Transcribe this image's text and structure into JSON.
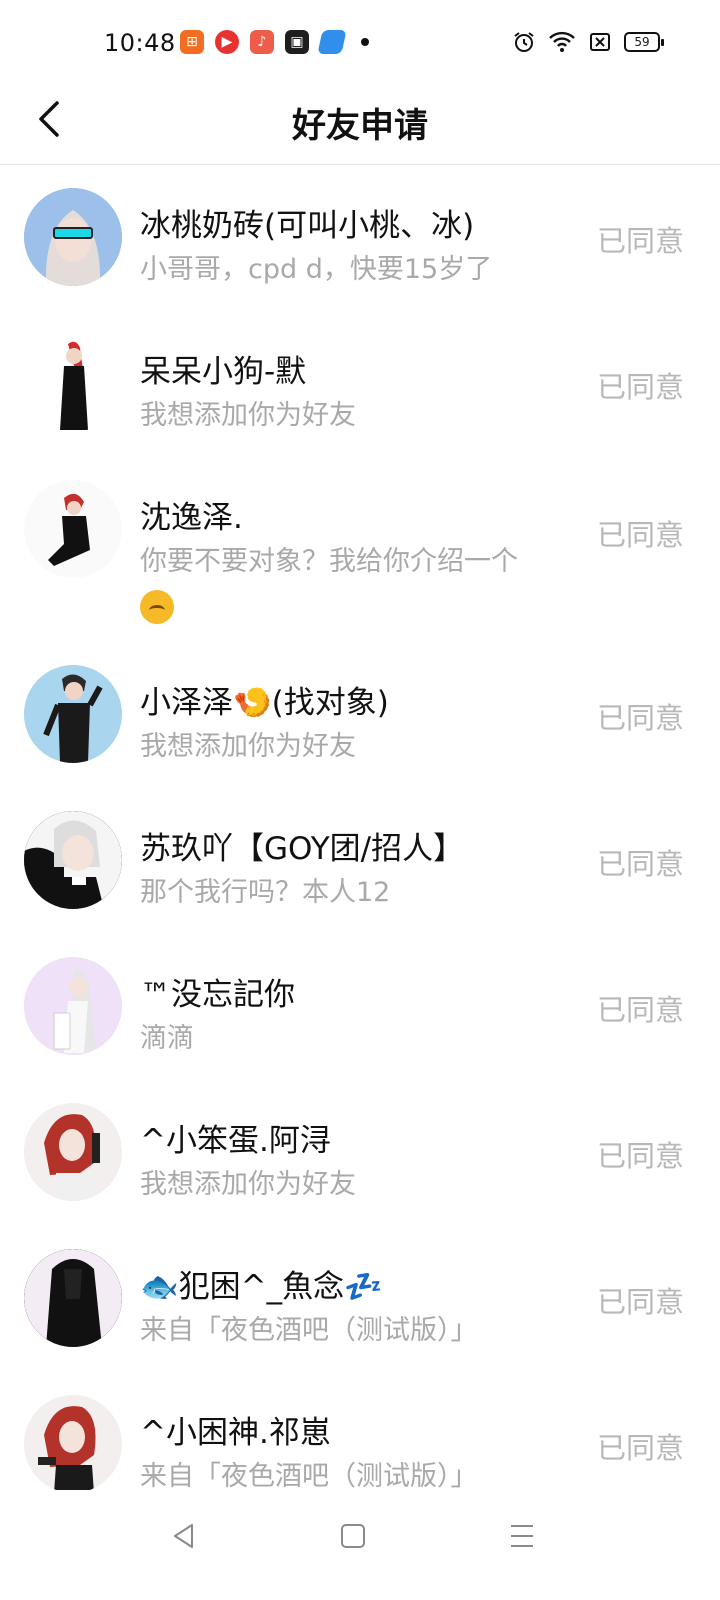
{
  "status_bar": {
    "time": "10:48",
    "battery": "59",
    "app_icons": [
      {
        "name": "app-icon-orange",
        "color": "#f26d21"
      },
      {
        "name": "app-icon-red",
        "color": "#e8322f"
      },
      {
        "name": "app-icon-music",
        "color": "#ee5d4a"
      },
      {
        "name": "app-icon-video",
        "color": "#1e1e1e"
      },
      {
        "name": "app-icon-blue",
        "color": "#2f8fea"
      }
    ]
  },
  "header": {
    "title": "好友申请",
    "back_icon": "chevron-left-icon"
  },
  "requests": [
    {
      "name": "冰桃奶砖(可叫小桃、冰)",
      "message": "小哥哥，cpd d，快要15岁了",
      "status": "已同意",
      "avatar_bg": "#8fb8e6"
    },
    {
      "name": "呆呆小狗-默",
      "message": "我想添加你为好友",
      "status": "已同意",
      "avatar_bg": "#ffffff"
    },
    {
      "name": "沈逸泽.",
      "message": "你要不要对象？我给你介绍一个",
      "status": "已同意",
      "avatar_bg": "#ffffff"
    },
    {
      "name": "小泽泽🍤(找对象)",
      "message": "我想添加你为好友",
      "status": "已同意",
      "avatar_bg": "#a9d6ee"
    },
    {
      "name": "苏玖吖【GOY团/招人】",
      "message": "那个我行吗？本人12",
      "status": "已同意",
      "avatar_bg": "#222222"
    },
    {
      "name": "™没忘記你",
      "message": "滴滴",
      "status": "已同意",
      "avatar_bg": "#eeddf7"
    },
    {
      "name": "^小笨蛋.阿浔",
      "message": "我想添加你为好友",
      "status": "已同意",
      "avatar_bg": "#f2eded"
    },
    {
      "name": "🐟犯困^_魚念💤",
      "message": "来自「夜色酒吧（测试版）」",
      "status": "已同意",
      "avatar_bg": "#151515"
    },
    {
      "name": "^小困神.祁崽",
      "message": "来自「夜色酒吧（测试版）」",
      "status": "已同意",
      "avatar_bg": "#f2eded"
    }
  ],
  "nav_bar": {
    "back": "nav-back-icon",
    "home": "nav-home-icon",
    "menu": "nav-menu-icon"
  }
}
